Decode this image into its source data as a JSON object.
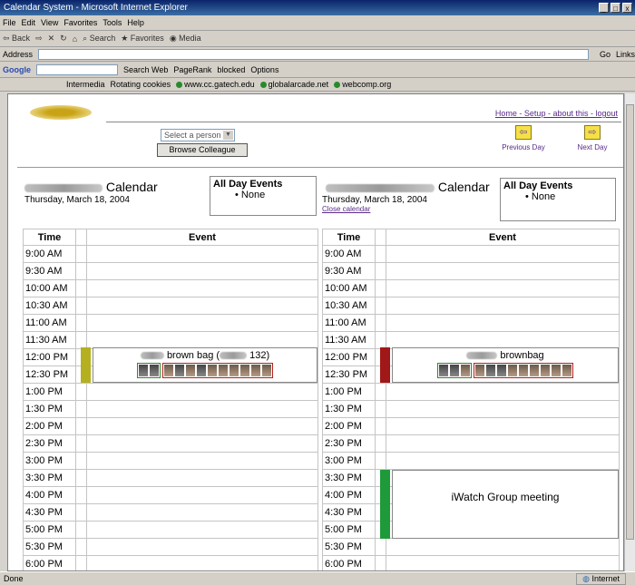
{
  "window": {
    "title": "Calendar System - Microsoft Internet Explorer"
  },
  "menubar": [
    "File",
    "Edit",
    "View",
    "Favorites",
    "Tools",
    "Help"
  ],
  "toolbar": {
    "back": "Back",
    "search": "Search",
    "favorites": "Favorites",
    "media": "Media"
  },
  "addressbar": {
    "label": "Address",
    "go": "Go",
    "links": "Links"
  },
  "googlebar": {
    "label": "Google",
    "search_web": "Search Web",
    "pagerank": "PageRank",
    "blocked": "blocked",
    "options": "Options"
  },
  "linksbar": [
    "Intermedia",
    "Rotating cookies",
    "www.cc.gatech.edu",
    "globalarcade.net",
    "webcomp.org"
  ],
  "page": {
    "toplinks": "Home - Setup - about this - logout",
    "select_value": "Select a person",
    "colleague_button": "Browse Colleague",
    "prev_day": "Previous Day",
    "next_day": "Next Day"
  },
  "left_cal": {
    "title": "Calendar",
    "date": "Thursday, March 18, 2004",
    "allday_title": "All Day Events",
    "allday_none": "None",
    "time_header": "Time",
    "event_header": "Event",
    "times": [
      "9:00 AM",
      "9:30 AM",
      "10:00 AM",
      "10:30 AM",
      "11:00 AM",
      "11:30 AM",
      "12:00 PM",
      "12:30 PM",
      "1:00 PM",
      "1:30 PM",
      "2:00 PM",
      "2:30 PM",
      "3:00 PM",
      "3:30 PM",
      "4:00 PM",
      "4:30 PM",
      "5:00 PM",
      "5:30 PM",
      "6:00 PM"
    ],
    "event1_text": "brown bag (",
    "event1_text2": "132)",
    "event1_color": "#b5b020"
  },
  "right_cal": {
    "title": "Calendar",
    "date": "Thursday, March 18, 2004",
    "sublink": "Close calendar",
    "allday_title": "All Day Events",
    "allday_none": "None",
    "time_header": "Time",
    "event_header": "Event",
    "times": [
      "9:00 AM",
      "9:30 AM",
      "10:00 AM",
      "10:30 AM",
      "11:00 AM",
      "11:30 AM",
      "12:00 PM",
      "12:30 PM",
      "1:00 PM",
      "1:30 PM",
      "2:00 PM",
      "2:30 PM",
      "3:00 PM",
      "3:30 PM",
      "4:00 PM",
      "4:30 PM",
      "5:00 PM",
      "5:30 PM",
      "6:00 PM"
    ],
    "event1_text": "brownbag",
    "event1_color": "#a01818",
    "event2_text": "iWatch Group meeting",
    "event2_color": "#1f9a3a"
  },
  "status": {
    "text": "Done",
    "zone": "Internet"
  }
}
